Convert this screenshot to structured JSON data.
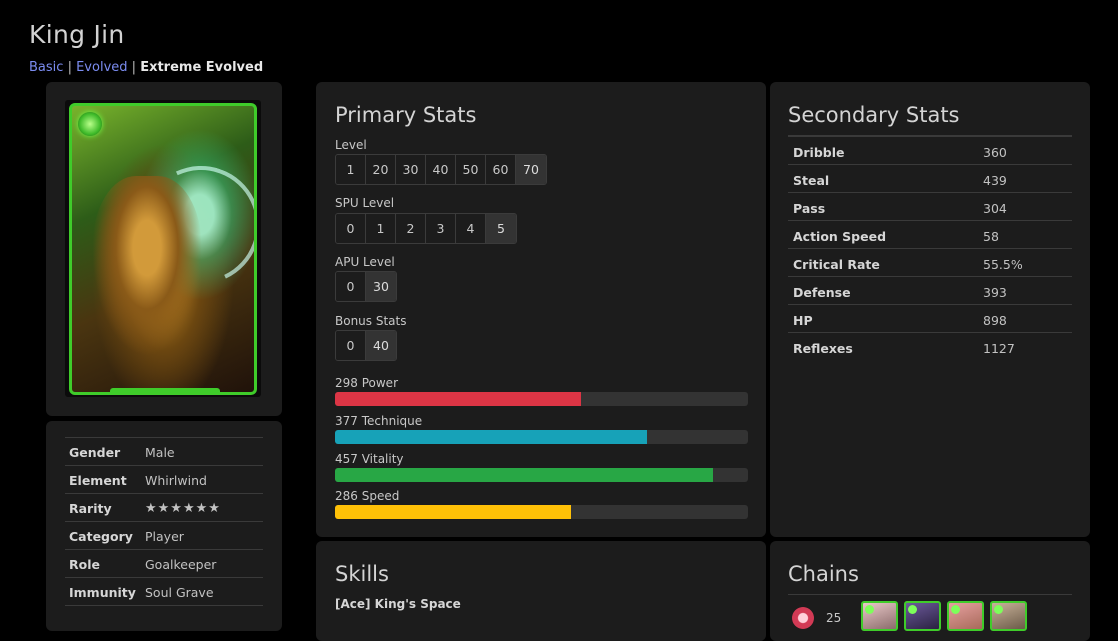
{
  "page": {
    "title": "King Jin"
  },
  "breadcrumb": {
    "basic": "Basic",
    "evolved": "Evolved",
    "extreme": "Extreme Evolved",
    "sep": "|"
  },
  "card": {
    "image_alt": "King Jin card art"
  },
  "info": {
    "rows": [
      {
        "key": "Gender",
        "value": "Male"
      },
      {
        "key": "Element",
        "value": "Whirlwind"
      },
      {
        "key": "Rarity",
        "value": "★★★★★★"
      },
      {
        "key": "Category",
        "value": "Player"
      },
      {
        "key": "Role",
        "value": "Goalkeeper"
      },
      {
        "key": "Immunity",
        "value": "Soul Grave"
      }
    ]
  },
  "primary": {
    "heading": "Primary Stats",
    "level": {
      "label": "Level",
      "options": [
        "1",
        "20",
        "30",
        "40",
        "50",
        "60",
        "70"
      ],
      "selected": "70"
    },
    "spu": {
      "label": "SPU Level",
      "options": [
        "0",
        "1",
        "2",
        "3",
        "4",
        "5"
      ],
      "selected": "5"
    },
    "apu": {
      "label": "APU Level",
      "options": [
        "0",
        "30"
      ],
      "selected": "30"
    },
    "bonus": {
      "label": "Bonus Stats",
      "options": [
        "0",
        "40"
      ],
      "selected": "40"
    },
    "bars": [
      {
        "label": "298 Power",
        "fraction": 0.595,
        "color": "#dc3545"
      },
      {
        "label": "377 Technique",
        "fraction": 0.755,
        "color": "#17a2b8"
      },
      {
        "label": "457 Vitality",
        "fraction": 0.915,
        "color": "#28a745"
      },
      {
        "label": "286 Speed",
        "fraction": 0.571,
        "color": "#ffc107"
      }
    ]
  },
  "secondary": {
    "heading": "Secondary Stats",
    "rows": [
      {
        "key": "Dribble",
        "value": "360"
      },
      {
        "key": "Steal",
        "value": "439"
      },
      {
        "key": "Pass",
        "value": "304"
      },
      {
        "key": "Action Speed",
        "value": "58"
      },
      {
        "key": "Critical Rate",
        "value": "55.5%"
      },
      {
        "key": "Defense",
        "value": "393"
      },
      {
        "key": "HP",
        "value": "898"
      },
      {
        "key": "Reflexes",
        "value": "1127"
      }
    ]
  },
  "skills": {
    "heading": "Skills",
    "first_skill": "[Ace] King's Space"
  },
  "chains": {
    "heading": "Chains",
    "count": "25"
  }
}
